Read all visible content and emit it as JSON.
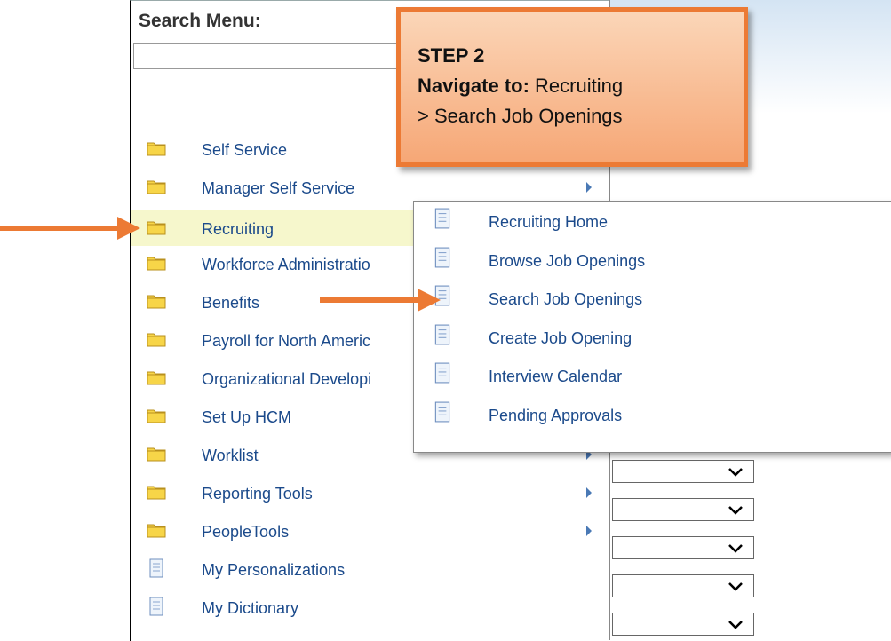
{
  "search": {
    "label": "Search Menu:",
    "value": ""
  },
  "menu": {
    "items": [
      {
        "label": "Self Service",
        "icon": "folder-icon",
        "has_submenu": false
      },
      {
        "label": "Manager Self Service",
        "icon": "folder-icon",
        "has_submenu": true
      },
      {
        "label": "Recruiting",
        "icon": "folder-icon",
        "has_submenu": true
      },
      {
        "label": "Workforce Administratio",
        "icon": "folder-icon",
        "has_submenu": false
      },
      {
        "label": "Benefits",
        "icon": "folder-icon",
        "has_submenu": false
      },
      {
        "label": "Payroll for North Americ",
        "icon": "folder-icon",
        "has_submenu": false
      },
      {
        "label": "Organizational Developi",
        "icon": "folder-icon",
        "has_submenu": false
      },
      {
        "label": "Set Up HCM",
        "icon": "folder-icon",
        "has_submenu": false
      },
      {
        "label": "Worklist",
        "icon": "folder-icon",
        "has_submenu": true
      },
      {
        "label": "Reporting Tools",
        "icon": "folder-icon",
        "has_submenu": true
      },
      {
        "label": "PeopleTools",
        "icon": "folder-icon",
        "has_submenu": true
      },
      {
        "label": "My Personalizations",
        "icon": "document-icon",
        "has_submenu": false
      },
      {
        "label": "My Dictionary",
        "icon": "document-icon",
        "has_submenu": false
      }
    ]
  },
  "submenu": {
    "items": [
      {
        "label": "Recruiting Home",
        "icon": "document-icon"
      },
      {
        "label": "Browse Job Openings",
        "icon": "document-icon"
      },
      {
        "label": "Search Job Openings",
        "icon": "document-icon"
      },
      {
        "label": "Create Job Opening",
        "icon": "document-icon"
      },
      {
        "label": "Interview Calendar",
        "icon": "document-icon"
      },
      {
        "label": "Pending Approvals",
        "icon": "document-icon"
      }
    ]
  },
  "callout": {
    "title": "STEP 2",
    "nav_label": "Navigate to:",
    "nav_path_1": "Recruiting",
    "nav_path_2": "> Search Job Openings"
  },
  "colors": {
    "accent": "#ec7a34",
    "link": "#1b4a8b",
    "highlight": "#f6f7cc"
  }
}
